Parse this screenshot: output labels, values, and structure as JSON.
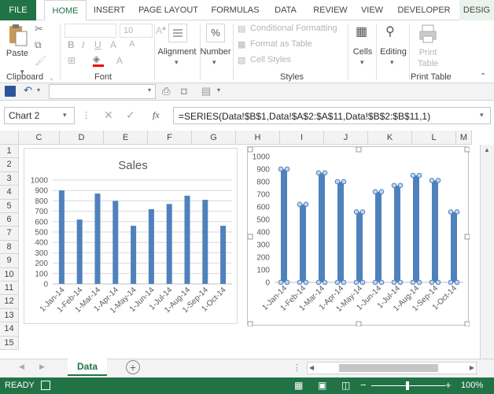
{
  "tabs": {
    "file": "FILE",
    "home": "HOME",
    "insert": "INSERT",
    "page_layout": "PAGE LAYOUT",
    "formulas": "FORMULAS",
    "data": "DATA",
    "review": "REVIEW",
    "view": "VIEW",
    "developer": "DEVELOPER",
    "design": "DESIG"
  },
  "ribbon": {
    "paste": "Paste",
    "clipboard": "Clipboard",
    "font_size": "10",
    "font": "Font",
    "alignment": "Alignment",
    "number": "Number",
    "conditional_formatting": "Conditional Formatting",
    "format_as_table": "Format as Table",
    "cell_styles": "Cell Styles",
    "styles": "Styles",
    "cells": "Cells",
    "editing": "Editing",
    "print_table_btn": [
      "Print",
      "Table"
    ],
    "print_table": "Print Table"
  },
  "formula_bar": {
    "name_box": "Chart 2",
    "fx": "fx",
    "formula": "=SERIES(Data!$B$1,Data!$A$2:$A$11,Data!$B$2:$B$11,1)"
  },
  "columns": [
    "C",
    "D",
    "E",
    "F",
    "G",
    "H",
    "I",
    "J",
    "K",
    "L",
    "M"
  ],
  "rows": [
    "1",
    "2",
    "3",
    "4",
    "5",
    "6",
    "7",
    "8",
    "9",
    "10",
    "11",
    "12",
    "13",
    "14",
    "15"
  ],
  "chart_data": [
    {
      "type": "bar",
      "title": "Sales",
      "categories": [
        "1-Jan-14",
        "1-Feb-14",
        "1-Mar-14",
        "1-Apr-14",
        "1-May-14",
        "1-Jun-14",
        "1-Jul-14",
        "1-Aug-14",
        "1-Sep-14",
        "1-Oct-14"
      ],
      "values": [
        900,
        620,
        870,
        800,
        560,
        720,
        770,
        850,
        810,
        560
      ],
      "ylim": [
        0,
        1000
      ],
      "yticks": [
        "0",
        "100",
        "200",
        "300",
        "400",
        "500",
        "600",
        "700",
        "800",
        "900",
        "1000"
      ],
      "grid": true,
      "color": "#4f81bd"
    },
    {
      "type": "bar",
      "title": "",
      "categories": [
        "1-Jan-14",
        "1-Feb-14",
        "1-Mar-14",
        "1-Apr-14",
        "1-May-14",
        "1-Jun-14",
        "1-Jul-14",
        "1-Aug-14",
        "1-Sep-14",
        "1-Oct-14"
      ],
      "values": [
        900,
        620,
        870,
        800,
        560,
        720,
        770,
        850,
        810,
        560
      ],
      "ylim": [
        0,
        1000
      ],
      "yticks": [
        "0",
        "100",
        "200",
        "300",
        "400",
        "500",
        "600",
        "700",
        "800",
        "900",
        "1000"
      ],
      "grid": false,
      "selected": true,
      "color": "#4f81bd"
    }
  ],
  "sheet_tabs": [
    "Data"
  ],
  "status": {
    "ready": "READY",
    "zoom": "100%"
  },
  "colors": {
    "excel_green": "#217346",
    "bar": "#4f81bd"
  }
}
